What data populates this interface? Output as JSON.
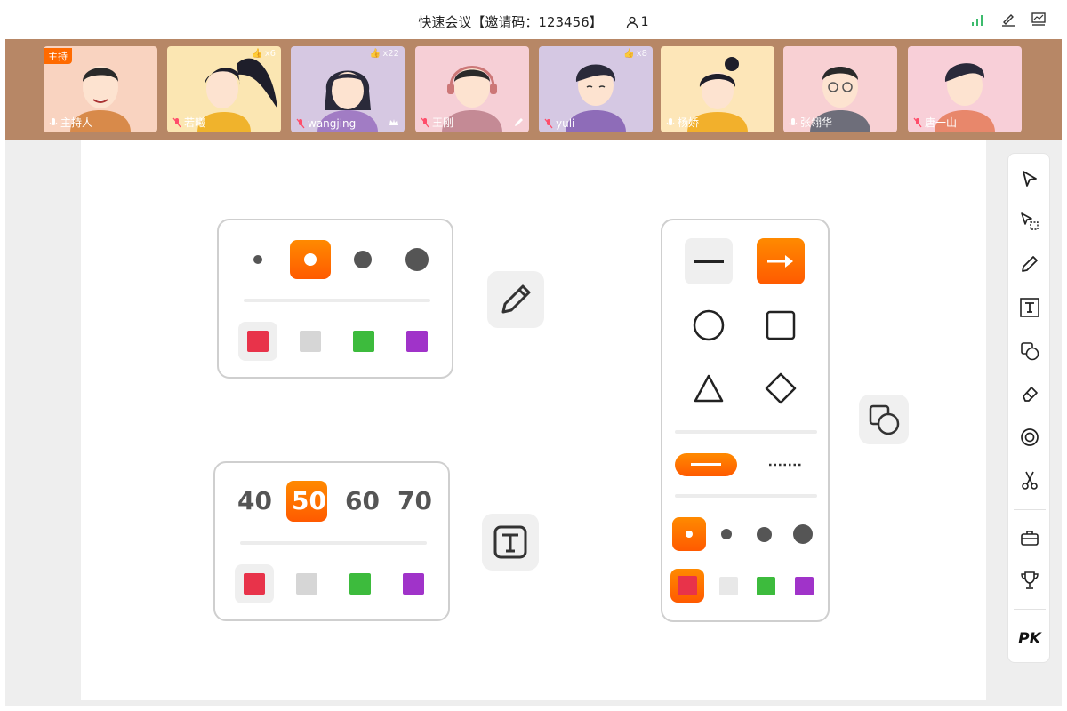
{
  "header": {
    "title": "快速会议【邀请码：123456】",
    "participants": "1",
    "icons": [
      "signal-icon",
      "edit-icon",
      "screen-icon"
    ]
  },
  "participants": [
    {
      "name": "主持人",
      "host_tag": "主持",
      "badge": "",
      "bg": "#f9d3c0",
      "mic": "mic-on"
    },
    {
      "name": "若曦",
      "badge": "x6",
      "bg": "#fbe6b2",
      "mic": "mic-off"
    },
    {
      "name": "wangjing",
      "badge": "x22",
      "bg": "#d6c8e2",
      "mic": "mic-off",
      "corner": "crown-icon"
    },
    {
      "name": "王刚",
      "badge": "",
      "bg": "#f6cfd6",
      "mic": "mic-off",
      "corner": "pencil-icon"
    },
    {
      "name": "yuli",
      "badge": "x8",
      "bg": "#d5c8e3",
      "mic": "mic-off"
    },
    {
      "name": "杨娇",
      "badge": "",
      "bg": "#fde6b8",
      "mic": "mic-on"
    },
    {
      "name": "张翎华",
      "badge": "",
      "bg": "#f8d0d3",
      "mic": "mic-on"
    },
    {
      "name": "唐一山",
      "badge": "",
      "bg": "#f8cfd8",
      "mic": "mic-off"
    }
  ],
  "pen_panel": {
    "sizes": [
      "small",
      "medium",
      "large",
      "xlarge"
    ],
    "selected_size": 1,
    "colors": [
      "#e8334a",
      "#d6d6d6",
      "#3dbb3d",
      "#a033c9"
    ],
    "selected_color": 0
  },
  "text_panel": {
    "sizes": [
      "40",
      "50",
      "60",
      "70"
    ],
    "selected_size": 1,
    "colors": [
      "#e8334a",
      "#d6d6d6",
      "#3dbb3d",
      "#a033c9"
    ],
    "selected_color": 0
  },
  "shape_panel": {
    "shapes": [
      "line",
      "arrow",
      "circle",
      "square",
      "triangle",
      "diamond"
    ],
    "selected_shape": "arrow",
    "line_styles": [
      "solid",
      "dotted"
    ],
    "selected_line_style": "solid",
    "colors": [
      "#e8334a",
      "#d6d6d6",
      "#3dbb3d",
      "#a033c9"
    ],
    "selected_color": 0
  },
  "toolbar": {
    "tools": [
      "select-icon",
      "multi-select-icon",
      "pen-icon",
      "text-icon",
      "shape-icon",
      "eraser-icon",
      "laser-icon",
      "scissors-icon",
      "toolbox-icon",
      "trophy-icon"
    ],
    "pk_label": "PK"
  },
  "colors": {
    "accent": "#ff6a00",
    "strip_bg": "#b78766"
  }
}
